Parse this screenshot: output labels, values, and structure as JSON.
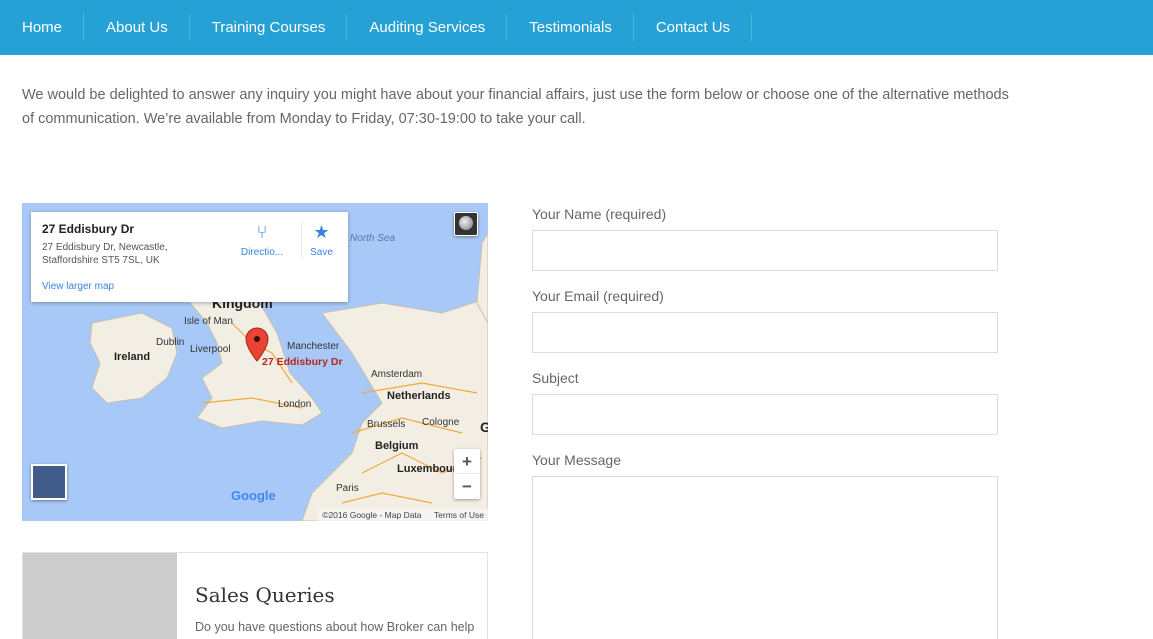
{
  "nav": {
    "items": [
      {
        "label": "Home"
      },
      {
        "label": "About Us"
      },
      {
        "label": "Training Courses"
      },
      {
        "label": "Auditing Services"
      },
      {
        "label": "Testimonials"
      },
      {
        "label": "Contact Us"
      }
    ],
    "bg_color": "#25a1d6"
  },
  "intro": "We would be delighted to answer any inquiry you might have about your financial affairs, just use the form below or choose one of the alternative methods of communication. We’re available from Monday to Friday, 07:30-19:00 to take your call.",
  "map": {
    "card": {
      "title": "27 Eddisbury Dr",
      "address": "27 Eddisbury Dr, Newcastle, Staffordshire ST5 7SL, UK",
      "directions_label": "Directio...",
      "save_label": "Save",
      "larger_map_label": "View larger map",
      "directions_icon": "directions-icon",
      "save_icon": "star-icon"
    },
    "labels": {
      "north_sea": "North Sea",
      "kingdom": "Kingdom",
      "isle_of_man": "Isle of Man",
      "dublin": "Dublin",
      "ireland": "Ireland",
      "liverpool": "Liverpool",
      "manchester": "Manchester",
      "pin": "27 Eddisbury Dr",
      "amsterdam": "Amsterdam",
      "netherlands": "Netherlands",
      "london": "London",
      "brussels": "Brussels",
      "cologne": "Cologne",
      "belgium": "Belgium",
      "luxembourg": "Luxembourg",
      "paris": "Paris",
      "g": "G"
    },
    "zoom_in": "+",
    "zoom_out": "−",
    "google": "Google",
    "copyright": "©2016 Google - Map Data",
    "terms": "Terms of Use"
  },
  "sales": {
    "title": "Sales Queries",
    "text": "Do you have questions about how Broker can help"
  },
  "form": {
    "name_label": "Your Name (required)",
    "email_label": "Your Email (required)",
    "subject_label": "Subject",
    "message_label": "Your Message"
  }
}
